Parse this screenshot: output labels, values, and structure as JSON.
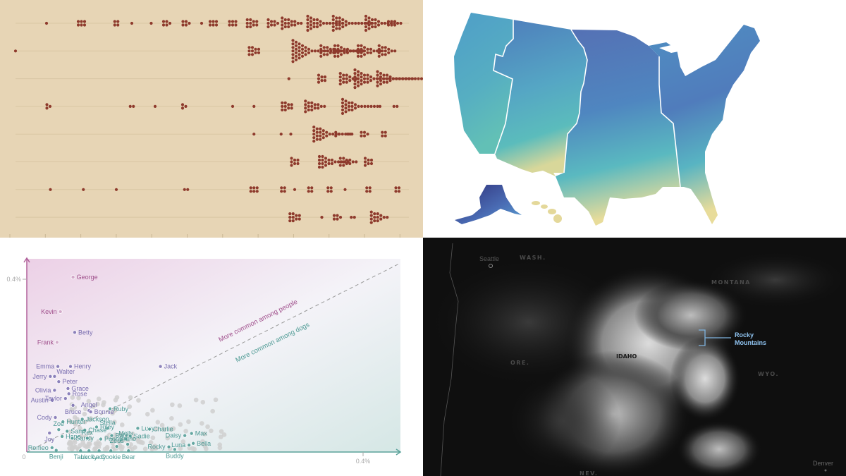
{
  "panels": {
    "beeswarm": {
      "colors": {
        "background": "#e7d5b5",
        "dot": "#8e3a2c",
        "line": "#d9c6a4",
        "tick": "#c9b694"
      },
      "tick_count": 12,
      "rows": [
        {
          "clusters": [
            [
              0.08,
              1
            ],
            [
              0.17,
              6
            ],
            [
              0.26,
              4
            ],
            [
              0.3,
              1
            ],
            [
              0.35,
              1
            ],
            [
              0.39,
              5
            ],
            [
              0.44,
              5
            ],
            [
              0.48,
              1
            ],
            [
              0.51,
              6
            ],
            [
              0.56,
              6
            ],
            [
              0.61,
              10
            ],
            [
              0.66,
              8
            ],
            [
              0.7,
              16
            ],
            [
              0.77,
              24
            ],
            [
              0.84,
              26
            ],
            [
              0.92,
              24
            ],
            [
              0.97,
              6
            ]
          ]
        },
        {
          "clusters": [
            [
              0.0,
              1
            ],
            [
              0.615,
              10
            ],
            [
              0.74,
              44
            ],
            [
              0.8,
              16
            ],
            [
              0.84,
              20
            ],
            [
              0.9,
              18
            ],
            [
              0.95,
              14
            ]
          ]
        },
        {
          "clusters": [
            [
              0.705,
              1
            ],
            [
              0.79,
              7
            ],
            [
              0.85,
              14
            ],
            [
              0.9,
              40
            ],
            [
              0.95,
              24
            ]
          ]
        },
        {
          "clusters": [
            [
              0.085,
              3
            ],
            [
              0.3,
              2
            ],
            [
              0.36,
              1
            ],
            [
              0.435,
              3
            ],
            [
              0.56,
              1
            ],
            [
              0.615,
              1
            ],
            [
              0.7,
              10
            ],
            [
              0.76,
              16
            ],
            [
              0.86,
              24
            ],
            [
              0.94,
              1
            ],
            [
              0.98,
              2
            ]
          ]
        },
        {
          "clusters": [
            [
              0.615,
              1
            ],
            [
              0.685,
              1
            ],
            [
              0.71,
              1
            ],
            [
              0.79,
              26
            ],
            [
              0.83,
              3
            ],
            [
              0.86,
              2
            ],
            [
              0.9,
              5
            ],
            [
              0.95,
              4
            ]
          ]
        },
        {
          "clusters": [
            [
              0.72,
              7
            ],
            [
              0.8,
              20
            ],
            [
              0.85,
              12
            ],
            [
              0.91,
              7
            ]
          ]
        },
        {
          "clusters": [
            [
              0.09,
              1
            ],
            [
              0.175,
              1
            ],
            [
              0.26,
              1
            ],
            [
              0.44,
              2
            ],
            [
              0.615,
              6
            ],
            [
              0.69,
              4
            ],
            [
              0.72,
              1
            ],
            [
              0.76,
              4
            ],
            [
              0.81,
              4
            ],
            [
              0.85,
              1
            ],
            [
              0.91,
              4
            ],
            [
              0.985,
              4
            ]
          ]
        },
        {
          "clusters": [
            [
              0.72,
              10
            ],
            [
              0.79,
              1
            ],
            [
              0.83,
              5
            ],
            [
              0.87,
              2
            ],
            [
              0.93,
              14
            ]
          ]
        }
      ]
    },
    "map": {
      "colors": {
        "dark": "#33337e",
        "mid": "#4f78b8",
        "teal": "#58b6bf",
        "sand": "#e8dc9a",
        "border": "#ffffff"
      },
      "regions": [
        "Pacific",
        "Mountain",
        "Central",
        "Eastern",
        "Alaska",
        "Hawaii"
      ]
    },
    "scatter": {
      "y_tick": "0.4%",
      "x_tick": "0.4%",
      "origin": "0",
      "annotation_people": "More common among people",
      "annotation_dogs": "More common among dogs",
      "colors": {
        "people": "#a0508c",
        "mixed": "#7a6fb0",
        "dogs": "#4d9a94",
        "grey": "#cfcfcf",
        "axis_y": "#b0609a",
        "axis_x": "#5aa29a"
      },
      "names": [
        {
          "name": "George",
          "x": 0.055,
          "y": 0.405,
          "side": "right",
          "group": "people"
        },
        {
          "name": "Kevin",
          "x": 0.04,
          "y": 0.325,
          "side": "left",
          "group": "people"
        },
        {
          "name": "Betty",
          "x": 0.057,
          "y": 0.277,
          "side": "right",
          "group": "mixed"
        },
        {
          "name": "Frank",
          "x": 0.036,
          "y": 0.254,
          "side": "left",
          "group": "people"
        },
        {
          "name": "Emma",
          "x": 0.037,
          "y": 0.198,
          "side": "left",
          "group": "mixed"
        },
        {
          "name": "Henry",
          "x": 0.052,
          "y": 0.198,
          "side": "right",
          "group": "mixed"
        },
        {
          "name": "Jerry",
          "x": 0.028,
          "y": 0.175,
          "side": "left",
          "group": "mixed"
        },
        {
          "name": "Walter",
          "x": 0.033,
          "y": 0.175,
          "side": "right-up",
          "group": "mixed"
        },
        {
          "name": "Peter",
          "x": 0.038,
          "y": 0.163,
          "side": "right",
          "group": "mixed"
        },
        {
          "name": "Olivia",
          "x": 0.033,
          "y": 0.143,
          "side": "left",
          "group": "mixed"
        },
        {
          "name": "Grace",
          "x": 0.049,
          "y": 0.147,
          "side": "right",
          "group": "mixed"
        },
        {
          "name": "Rose",
          "x": 0.05,
          "y": 0.135,
          "side": "right",
          "group": "mixed"
        },
        {
          "name": "Austin",
          "x": 0.03,
          "y": 0.12,
          "side": "left",
          "group": "mixed"
        },
        {
          "name": "Taylor",
          "x": 0.046,
          "y": 0.124,
          "side": "left",
          "group": "mixed"
        },
        {
          "name": "Bruce",
          "x": 0.055,
          "y": 0.108,
          "side": "below",
          "group": "mixed"
        },
        {
          "name": "Jack",
          "x": 0.159,
          "y": 0.198,
          "side": "right",
          "group": "mixed"
        },
        {
          "name": "Angel",
          "x": 0.074,
          "y": 0.096,
          "side": "above",
          "group": "mixed"
        },
        {
          "name": "Bonnie",
          "x": 0.076,
          "y": 0.093,
          "side": "right",
          "group": "mixed"
        },
        {
          "name": "Ruby",
          "x": 0.099,
          "y": 0.1,
          "side": "right",
          "group": "dogs"
        },
        {
          "name": "Cody",
          "x": 0.034,
          "y": 0.08,
          "side": "left",
          "group": "mixed"
        },
        {
          "name": "Jackson",
          "x": 0.066,
          "y": 0.076,
          "side": "right",
          "group": "dogs"
        },
        {
          "name": "Hunter",
          "x": 0.043,
          "y": 0.07,
          "side": "right",
          "group": "dogs"
        },
        {
          "name": "Stella",
          "x": 0.096,
          "y": 0.055,
          "side": "above",
          "group": "dogs"
        },
        {
          "name": "Riley",
          "x": 0.083,
          "y": 0.058,
          "side": "right",
          "group": "dogs"
        },
        {
          "name": "Chase",
          "x": 0.069,
          "y": 0.051,
          "side": "right",
          "group": "dogs"
        },
        {
          "name": "Zoe",
          "x": 0.038,
          "y": 0.052,
          "side": "above",
          "group": "dogs"
        },
        {
          "name": "Sam",
          "x": 0.048,
          "y": 0.048,
          "side": "right",
          "group": "dogs"
        },
        {
          "name": "Joy",
          "x": 0.027,
          "y": 0.044,
          "side": "below",
          "group": "mixed"
        },
        {
          "name": "Hope",
          "x": 0.042,
          "y": 0.036,
          "side": "right",
          "group": "dogs"
        },
        {
          "name": "Sandy",
          "x": 0.054,
          "y": 0.032,
          "side": "right",
          "group": "dogs"
        },
        {
          "name": "Molly",
          "x": 0.118,
          "y": 0.03,
          "side": "above",
          "group": "dogs"
        },
        {
          "name": "Lucy",
          "x": 0.132,
          "y": 0.055,
          "side": "right",
          "group": "dogs"
        },
        {
          "name": "Charlie",
          "x": 0.146,
          "y": 0.053,
          "side": "right",
          "group": "dogs"
        },
        {
          "name": "Bailey",
          "x": 0.101,
          "y": 0.038,
          "side": "right",
          "group": "dogs"
        },
        {
          "name": "Sadie",
          "x": 0.123,
          "y": 0.037,
          "side": "right",
          "group": "dogs"
        },
        {
          "name": "Rex",
          "x": 0.072,
          "y": 0.032,
          "side": "above",
          "group": "dogs"
        },
        {
          "name": "Penny",
          "x": 0.088,
          "y": 0.03,
          "side": "right",
          "group": "dogs"
        },
        {
          "name": "Zeus",
          "x": 0.107,
          "y": 0.013,
          "side": "above",
          "group": "dogs"
        },
        {
          "name": "Bruno",
          "x": 0.12,
          "y": 0.018,
          "side": "above",
          "group": "dogs"
        },
        {
          "name": "Rocky",
          "x": 0.169,
          "y": 0.012,
          "side": "left",
          "group": "dogs"
        },
        {
          "name": "Daisy",
          "x": 0.188,
          "y": 0.038,
          "side": "left",
          "group": "dogs"
        },
        {
          "name": "Max",
          "x": 0.196,
          "y": 0.043,
          "side": "right",
          "group": "dogs"
        },
        {
          "name": "Luna",
          "x": 0.193,
          "y": 0.016,
          "side": "left",
          "group": "dogs"
        },
        {
          "name": "Bella",
          "x": 0.198,
          "y": 0.02,
          "side": "right",
          "group": "dogs"
        },
        {
          "name": "Buddy",
          "x": 0.176,
          "y": 0.006,
          "side": "below",
          "group": "dogs"
        },
        {
          "name": "Romeo",
          "x": 0.03,
          "y": 0.01,
          "side": "left",
          "group": "dogs"
        },
        {
          "name": "Benji",
          "x": 0.035,
          "y": 0.004,
          "side": "below",
          "group": "dogs"
        },
        {
          "name": "Tank",
          "x": 0.064,
          "y": 0.003,
          "side": "below",
          "group": "dogs"
        },
        {
          "name": "Lucky",
          "x": 0.074,
          "y": 0.003,
          "side": "below",
          "group": "dogs"
        },
        {
          "name": "Lady",
          "x": 0.086,
          "y": 0.003,
          "side": "below",
          "group": "dogs"
        },
        {
          "name": "Cookie",
          "x": 0.1,
          "y": 0.003,
          "side": "below",
          "group": "dogs"
        },
        {
          "name": "Bear",
          "x": 0.121,
          "y": 0.003,
          "side": "below",
          "group": "dogs"
        }
      ]
    },
    "satellite": {
      "labels": {
        "seattle": "Seattle",
        "wash": "WASH.",
        "montana": "MONTANA",
        "idaho": "IDAHO",
        "ore": "ORE.",
        "wyo": "WYO.",
        "nev": "NEV.",
        "denver": "Denver"
      },
      "callout": {
        "line1": "Rocky",
        "line2": "Mountains",
        "color": "#8fc3f0"
      }
    }
  }
}
